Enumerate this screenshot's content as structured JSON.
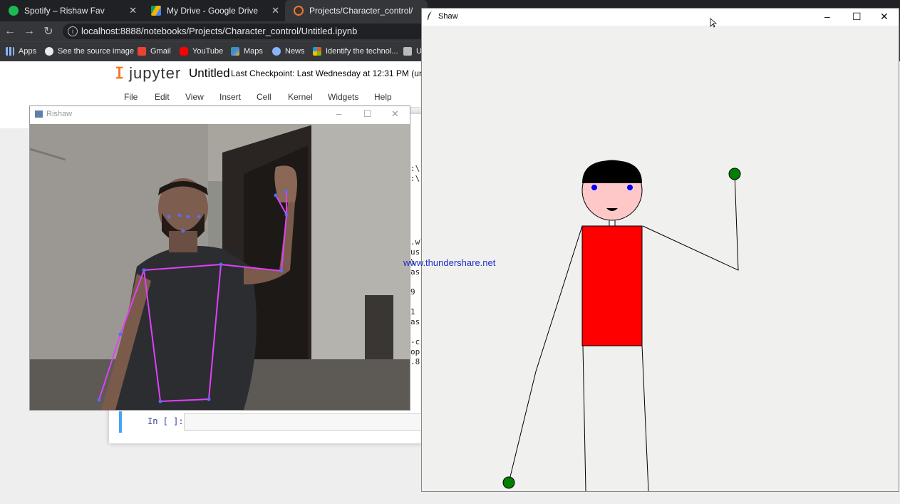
{
  "browser": {
    "tabs": [
      {
        "label": "Spotify – Rishaw Fav",
        "icon": "spotify-icon"
      },
      {
        "label": "My Drive - Google Drive",
        "icon": "google-drive-icon"
      },
      {
        "label": "Projects/Character_control/",
        "icon": "jupyter-icon"
      }
    ],
    "url": "localhost:8888/notebooks/Projects/Character_control/Untitled.ipynb",
    "bookmarks": [
      {
        "label": "Apps",
        "icon": "apps-grid-icon"
      },
      {
        "label": "See the source image",
        "icon": "globe-icon"
      },
      {
        "label": "Gmail",
        "icon": "gmail-icon"
      },
      {
        "label": "YouTube",
        "icon": "youtube-icon"
      },
      {
        "label": "Maps",
        "icon": "maps-icon"
      },
      {
        "label": "News",
        "icon": "news-icon"
      },
      {
        "label": "Identify the technol...",
        "icon": "microsoft-icon"
      },
      {
        "label": "U",
        "icon": "bookmark-icon"
      }
    ]
  },
  "jupyter": {
    "logo": "jupyter",
    "notebook_title": "Untitled",
    "checkpoint": "Last Checkpoint: Last Wednesday at 12:31 PM",
    "unsaved": "(unsave",
    "menu": [
      "File",
      "Edit",
      "View",
      "Insert",
      "Cell",
      "Kernel",
      "Widgets",
      "Help"
    ],
    "prompt": "In [ ]:",
    "output_fragments": [
      ":\\",
      ":\\",
      ".wl",
      "us",
      "\\",
      "as",
      "9 |",
      "1",
      "as",
      "-c",
      " op",
      ".8"
    ]
  },
  "camera_window": {
    "title": "Rishaw",
    "min": "–",
    "max": "☐",
    "close": "✕"
  },
  "shaw_window": {
    "title": "Shaw",
    "min": "–",
    "max": "☐",
    "close": "✕",
    "watermark": "www.thundershare.net"
  },
  "colors": {
    "skeleton": "#e040fb",
    "joint": "#5c6bf0",
    "body": "#ff0000",
    "head": "#ffc8c8",
    "hand": "#008000"
  }
}
